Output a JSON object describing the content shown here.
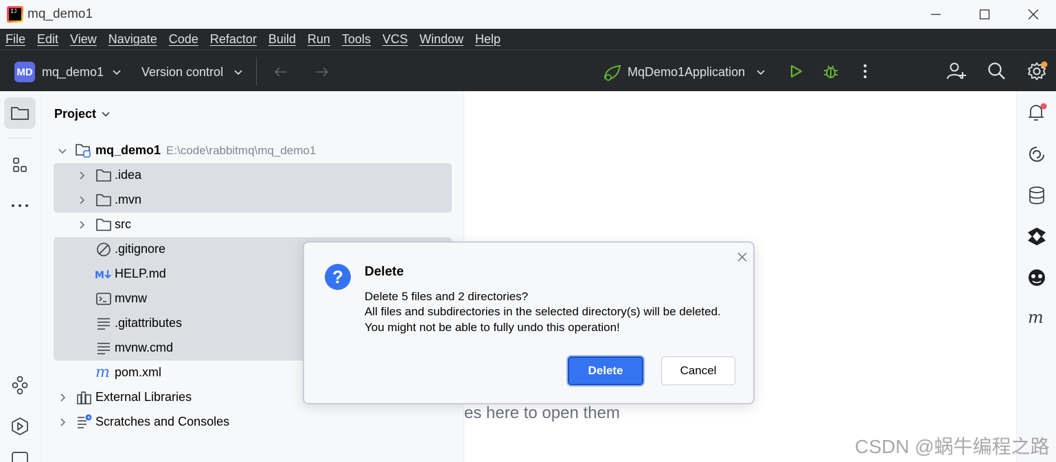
{
  "window": {
    "title": "mq_demo1",
    "logo_text": "IJ"
  },
  "menu": [
    "File",
    "Edit",
    "View",
    "Navigate",
    "Code",
    "Refactor",
    "Build",
    "Run",
    "Tools",
    "VCS",
    "Window",
    "Help"
  ],
  "toolbar": {
    "project_badge": "MD",
    "project_name": "mq_demo1",
    "vcs_label": "Version control",
    "run_config": "MqDemo1Application"
  },
  "project_panel": {
    "title": "Project",
    "root": {
      "name": "mq_demo1",
      "path": "E:\\code\\rabbitmq\\mq_demo1"
    },
    "items": [
      {
        "label": ".idea",
        "icon": "folder-icon",
        "expandable": true,
        "selected": true
      },
      {
        "label": ".mvn",
        "icon": "folder-icon",
        "expandable": true,
        "selected": true
      },
      {
        "label": "src",
        "icon": "folder-icon",
        "expandable": true,
        "selected": false
      },
      {
        "label": ".gitignore",
        "icon": "ignore-file-icon",
        "expandable": false,
        "selected": true
      },
      {
        "label": "HELP.md",
        "icon": "markdown-icon",
        "expandable": false,
        "selected": true
      },
      {
        "label": "mvnw",
        "icon": "shell-script-icon",
        "expandable": false,
        "selected": true
      },
      {
        "label": ".gitattributes",
        "icon": "text-file-icon",
        "expandable": false,
        "selected": true
      },
      {
        "label": "mvnw.cmd",
        "icon": "text-file-icon",
        "expandable": false,
        "selected": true
      },
      {
        "label": "pom.xml",
        "icon": "maven-icon",
        "expandable": false,
        "selected": false
      }
    ],
    "extra": [
      {
        "label": "External Libraries",
        "icon": "libraries-icon"
      },
      {
        "label": "Scratches and Consoles",
        "icon": "scratches-icon"
      }
    ]
  },
  "editor": {
    "hint_visible_fragment": "es here to open them"
  },
  "dialog": {
    "title": "Delete",
    "line1": "Delete 5 files and 2 directories?",
    "line2": "All files and subdirectories in the selected directory(s) will be deleted.",
    "line3": "You might not be able to fully undo this operation!",
    "confirm_label": "Delete",
    "cancel_label": "Cancel"
  },
  "watermark": "CSDN @蜗牛编程之路",
  "colors": {
    "accent": "#3574f0",
    "toolbar_bg": "#27282c",
    "run_green": "#5fb832",
    "notification_dot": "#e55765",
    "settings_dot": "#f2a33a"
  }
}
